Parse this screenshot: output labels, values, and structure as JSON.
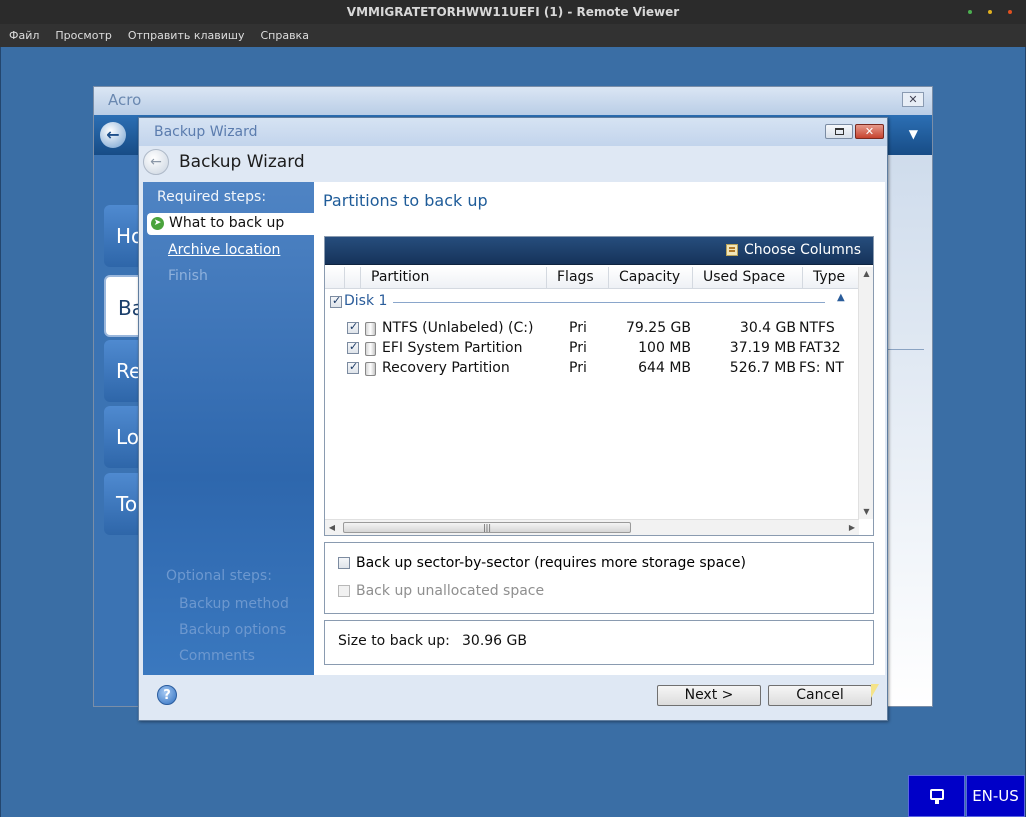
{
  "remote_viewer": {
    "title": "VMMIGRATETORHWW11UEFI (1) - Remote Viewer",
    "menu": [
      "Файл",
      "Просмотр",
      "Отправить клавишу",
      "Справка"
    ]
  },
  "background_window": {
    "title": "Acro",
    "close_label": "✕",
    "tiles": [
      "Ho",
      "Ba",
      "Re",
      "Lo",
      "To"
    ]
  },
  "wizard": {
    "window_title": "Backup Wizard",
    "heading": "Backup Wizard",
    "close_label": "✕",
    "steps": {
      "required_label": "Required steps:",
      "current": "What to back up",
      "archive_location": "Archive location",
      "finish": "Finish",
      "optional_label": "Optional steps:",
      "optional_items": [
        "Backup method",
        "Backup options",
        "Comments"
      ]
    },
    "content_title": "Partitions to back up",
    "choose_columns": "Choose Columns",
    "columns": [
      "Partition",
      "Flags",
      "Capacity",
      "Used Space",
      "Type"
    ],
    "disk": {
      "label": "Disk 1",
      "checked": true
    },
    "partitions": [
      {
        "name": "NTFS (Unlabeled) (C:)",
        "flags": "Pri",
        "capacity": "79.25 GB",
        "used": "30.4 GB",
        "type": "NTFS",
        "checked": true
      },
      {
        "name": "EFI System Partition",
        "flags": "Pri",
        "capacity": "100 MB",
        "used": "37.19 MB",
        "type": "FAT32",
        "checked": true
      },
      {
        "name": "Recovery Partition",
        "flags": "Pri",
        "capacity": "644 MB",
        "used": "526.7 MB",
        "type": "FS: NT",
        "checked": true
      }
    ],
    "options": {
      "sector_by_sector": "Back up sector-by-sector (requires more storage space)",
      "unallocated": "Back up unallocated space"
    },
    "size_label": "Size to back up:",
    "size_value": "30.96 GB",
    "help_label": "?",
    "next_label": "Next >",
    "cancel_label": "Cancel"
  },
  "taskbar": {
    "language": "EN-US"
  },
  "colors": {
    "accent": "#1f5c99",
    "steps_panel": "#2e67ad",
    "header_bar": "#16335a",
    "desktop": "#3a6ea5"
  },
  "icons": [
    "back-arrow-icon",
    "restore-icon",
    "close-icon",
    "arrow-right-icon",
    "columns-icon",
    "drive-icon",
    "chevron-up-icon",
    "help-icon",
    "keyboard-icon"
  ]
}
